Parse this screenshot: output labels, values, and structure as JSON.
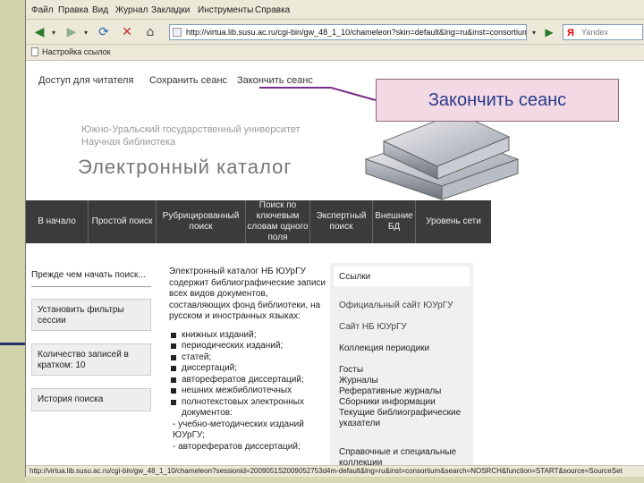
{
  "menu": [
    "Файл",
    "Правка",
    "Вид",
    "Журнал",
    "Закладки",
    "Инструменты",
    "Справка"
  ],
  "toolbar": {
    "address": "http://virtua.lib.susu.ac.ru/cgi-bin/gw_48_1_10/chameleon?skin=default&lng=ru&inst=consortium&cle",
    "search_placeholder": "Yandex",
    "search_logo": "Я"
  },
  "links_bar": {
    "item": "Настройка ссылок"
  },
  "top_nav": {
    "access": "Доступ для читателя",
    "save": "Сохранить сеанс",
    "end": "Закончить сеанс"
  },
  "header": {
    "univ_line1": "Южно-Уральский государственный университет",
    "univ_line2": "Научная библиотека",
    "catalog_title": "Электронный каталог"
  },
  "dark_nav": [
    "В начало",
    "Простой поиск",
    "Рубрицированный поиск",
    "Поиск по ключевым словам одного поля",
    "Экспертный поиск",
    "Внешние БД",
    "Уровень сети"
  ],
  "left_col": {
    "before_search": "Прежде чем начать поиск...",
    "filters": "Установить фильтры сессии",
    "records_count": "Количество записей в кратком: 10",
    "history": "История поиска"
  },
  "middle": {
    "intro": "Электронный каталог НБ ЮУрГУ содержит библиографические записи всех видов документов, составляющих фонд библиотеки, на русском и иностранных языках:",
    "items": [
      "книжных изданий;",
      "периодических изданий;",
      "статей;",
      "диссертаций;",
      "авторефератов диссертаций;",
      "нешних межбиблиотечных",
      "полнотекстовых электронных документов:"
    ],
    "dashes": [
      "- учебно-методических изданий ЮУрГУ;",
      "- авторефератов диссертаций;"
    ]
  },
  "right_col": {
    "header": "Ссылки",
    "official": "Официальный сайт ЮУрГУ",
    "nb_site": "Сайт НБ ЮУрГУ",
    "collection": "Коллекция периодики",
    "list": [
      "Госты",
      "Журналы",
      "Реферативные журналы",
      "Сборники информации",
      "Текущие библиографические указатели"
    ],
    "refs": "Справочные и специальные коллекции"
  },
  "status": "http://virtua.lib.susu.ac.ru/cgi-bin/gw_48_1_10/chameleon?sessionid=2009051S2009052753d4m-default&lng=ru&inst=consortium&search=NOSRCH&function=START&source=SourceSet",
  "callout": {
    "text": "Закончить сеанс",
    "bg": "#f2d9e3",
    "text_color": "#2b3a8c"
  }
}
